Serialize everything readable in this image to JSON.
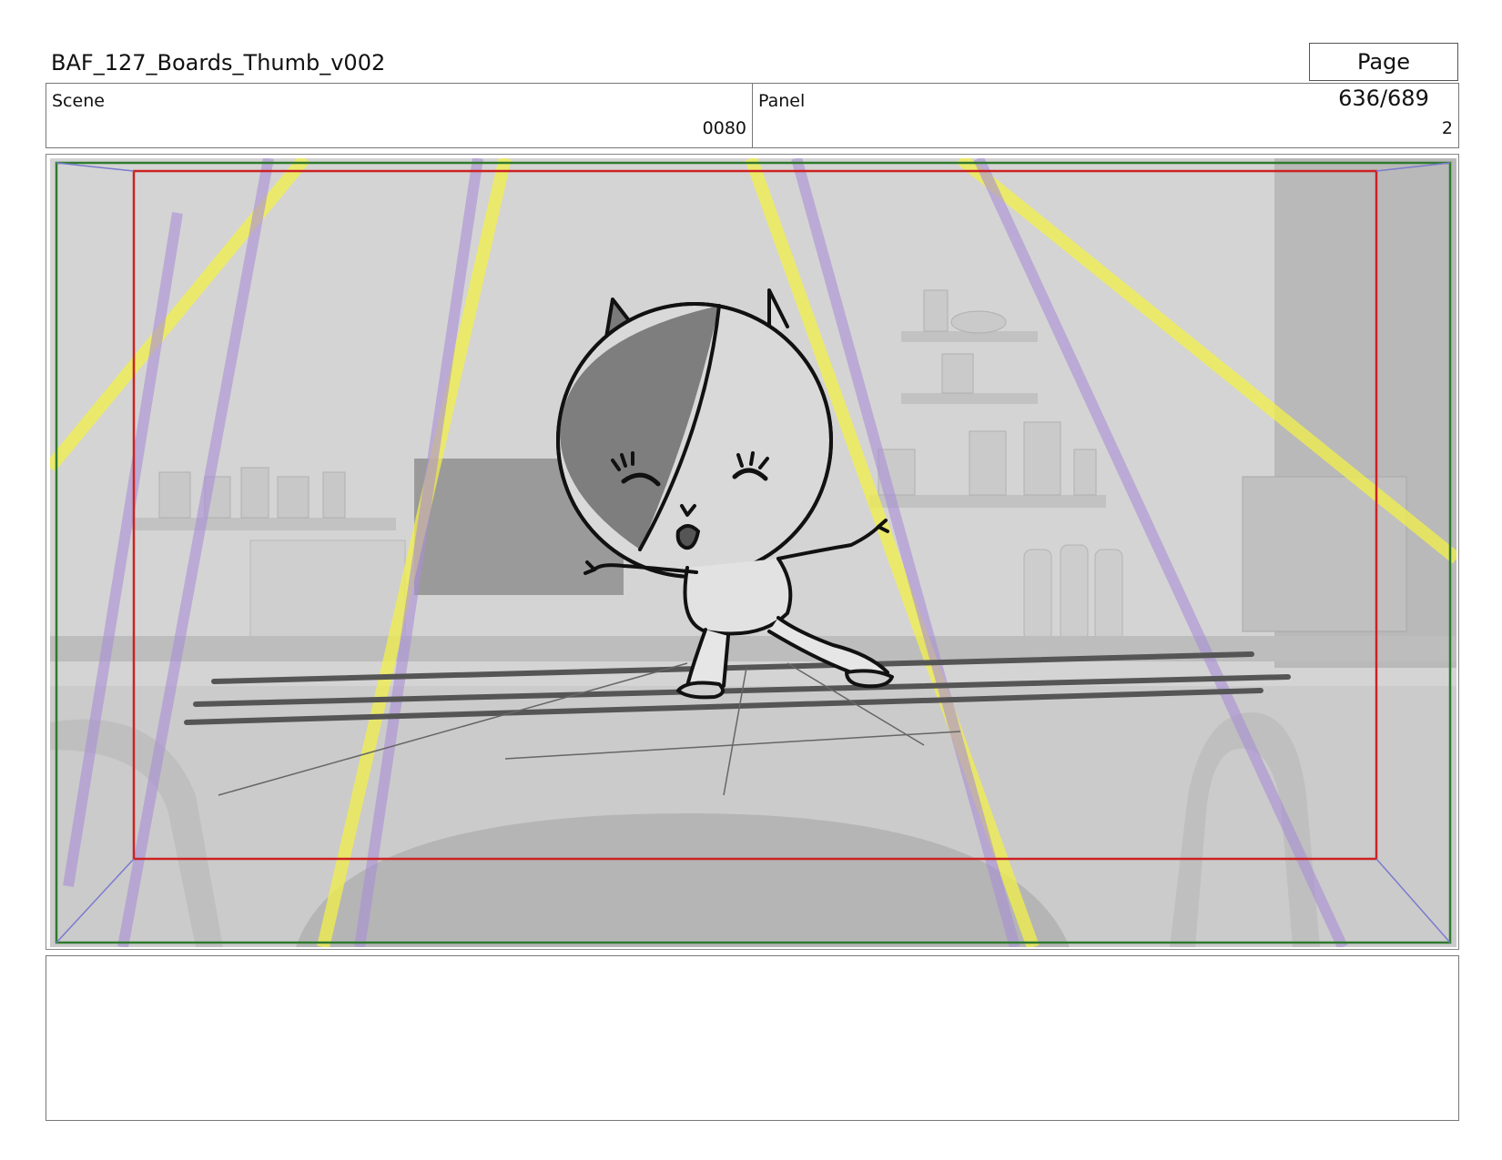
{
  "header": {
    "title": "BAF_127_Boards_Thumb_v002",
    "page": "Page 636/689"
  },
  "info": {
    "scene_label": "Scene",
    "scene_value": "0080",
    "panel_label": "Panel",
    "panel_value": "2"
  },
  "notes": {
    "text": ""
  },
  "colors": {
    "safe_frame": "#cc2222",
    "camera_frame": "#2f7a2f",
    "light_beam_yellow": "#f2f04a",
    "light_beam_purple": "#a98fd6"
  }
}
